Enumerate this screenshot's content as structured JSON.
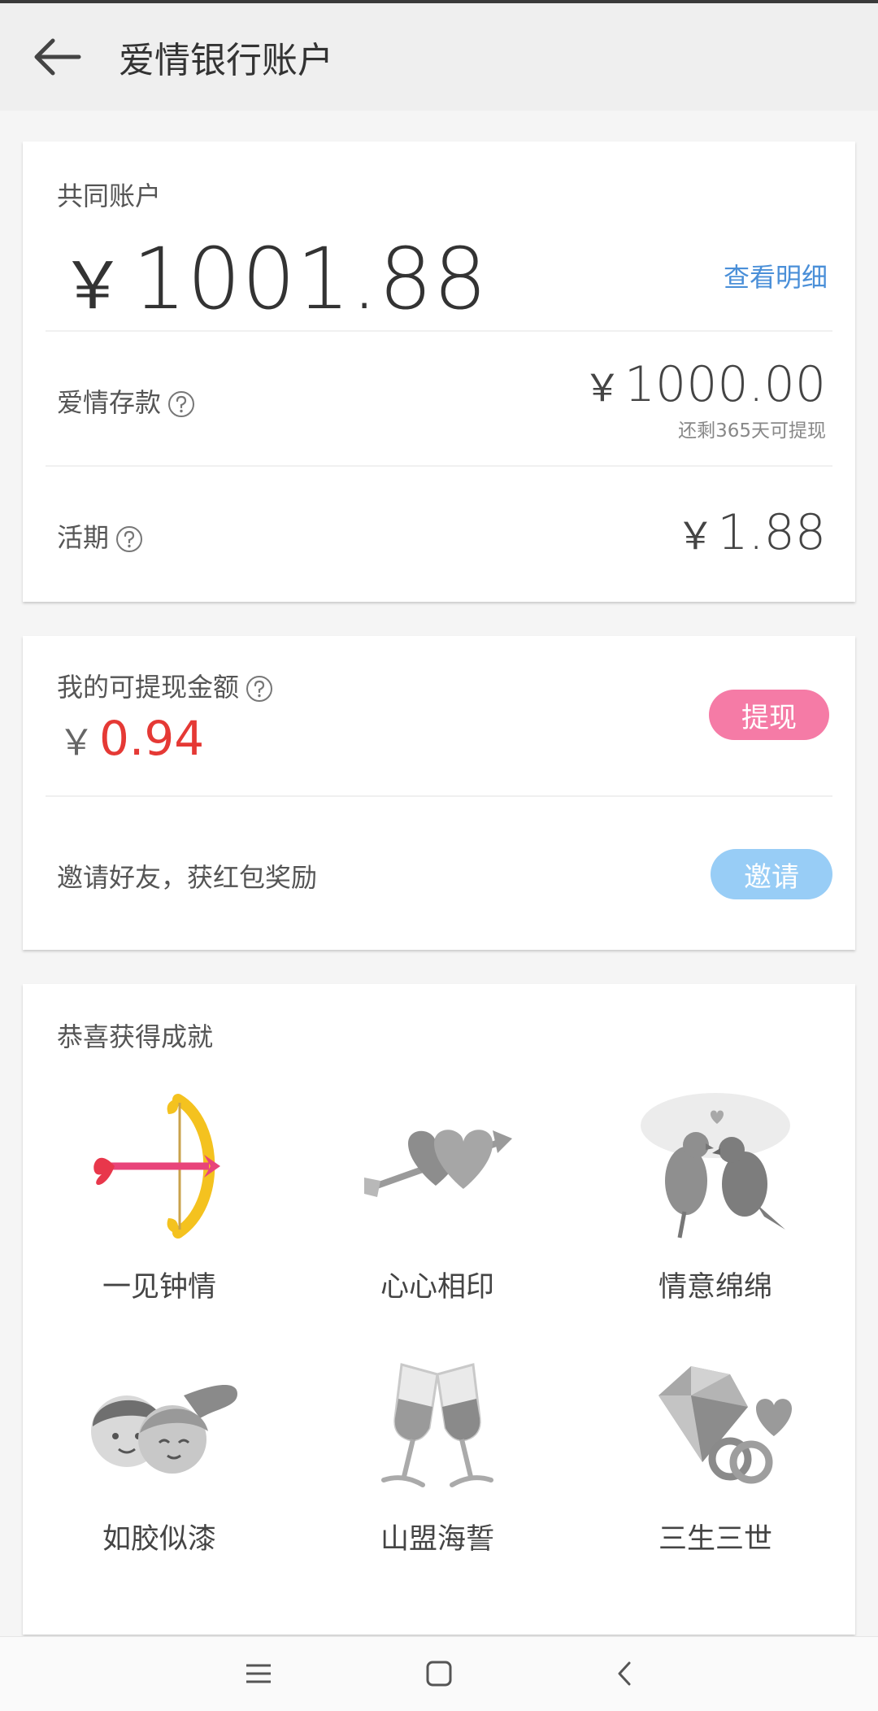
{
  "header": {
    "title": "爱情银行账户"
  },
  "account": {
    "label": "共同账户",
    "currency": "￥",
    "total": "1001.88",
    "detail_link": "查看明细",
    "deposit": {
      "label": "爱情存款",
      "amount": "1000.00",
      "note": "还剩365天可提现"
    },
    "current": {
      "label": "活期",
      "amount": "1.88"
    }
  },
  "withdraw": {
    "label": "我的可提现金额",
    "amount": "0.94",
    "button": "提现",
    "invite_text": "邀请好友，获红包奖励",
    "invite_button": "邀请"
  },
  "achievements": {
    "title": "恭喜获得成就",
    "items": [
      {
        "name": "一见钟情",
        "icon": "cupid-bow-icon",
        "unlocked": true
      },
      {
        "name": "心心相印",
        "icon": "hearts-arrow-icon",
        "unlocked": false
      },
      {
        "name": "情意绵绵",
        "icon": "lovebirds-icon",
        "unlocked": false
      },
      {
        "name": "如胶似漆",
        "icon": "couple-faces-icon",
        "unlocked": false
      },
      {
        "name": "山盟海誓",
        "icon": "champagne-glasses-icon",
        "unlocked": false
      },
      {
        "name": "三生三世",
        "icon": "diamond-rings-icon",
        "unlocked": false
      }
    ]
  },
  "colors": {
    "link": "#4a8fd8",
    "amount_red": "#e53935",
    "withdraw_pink": "#f57ba6",
    "invite_blue": "#98cdf6"
  }
}
